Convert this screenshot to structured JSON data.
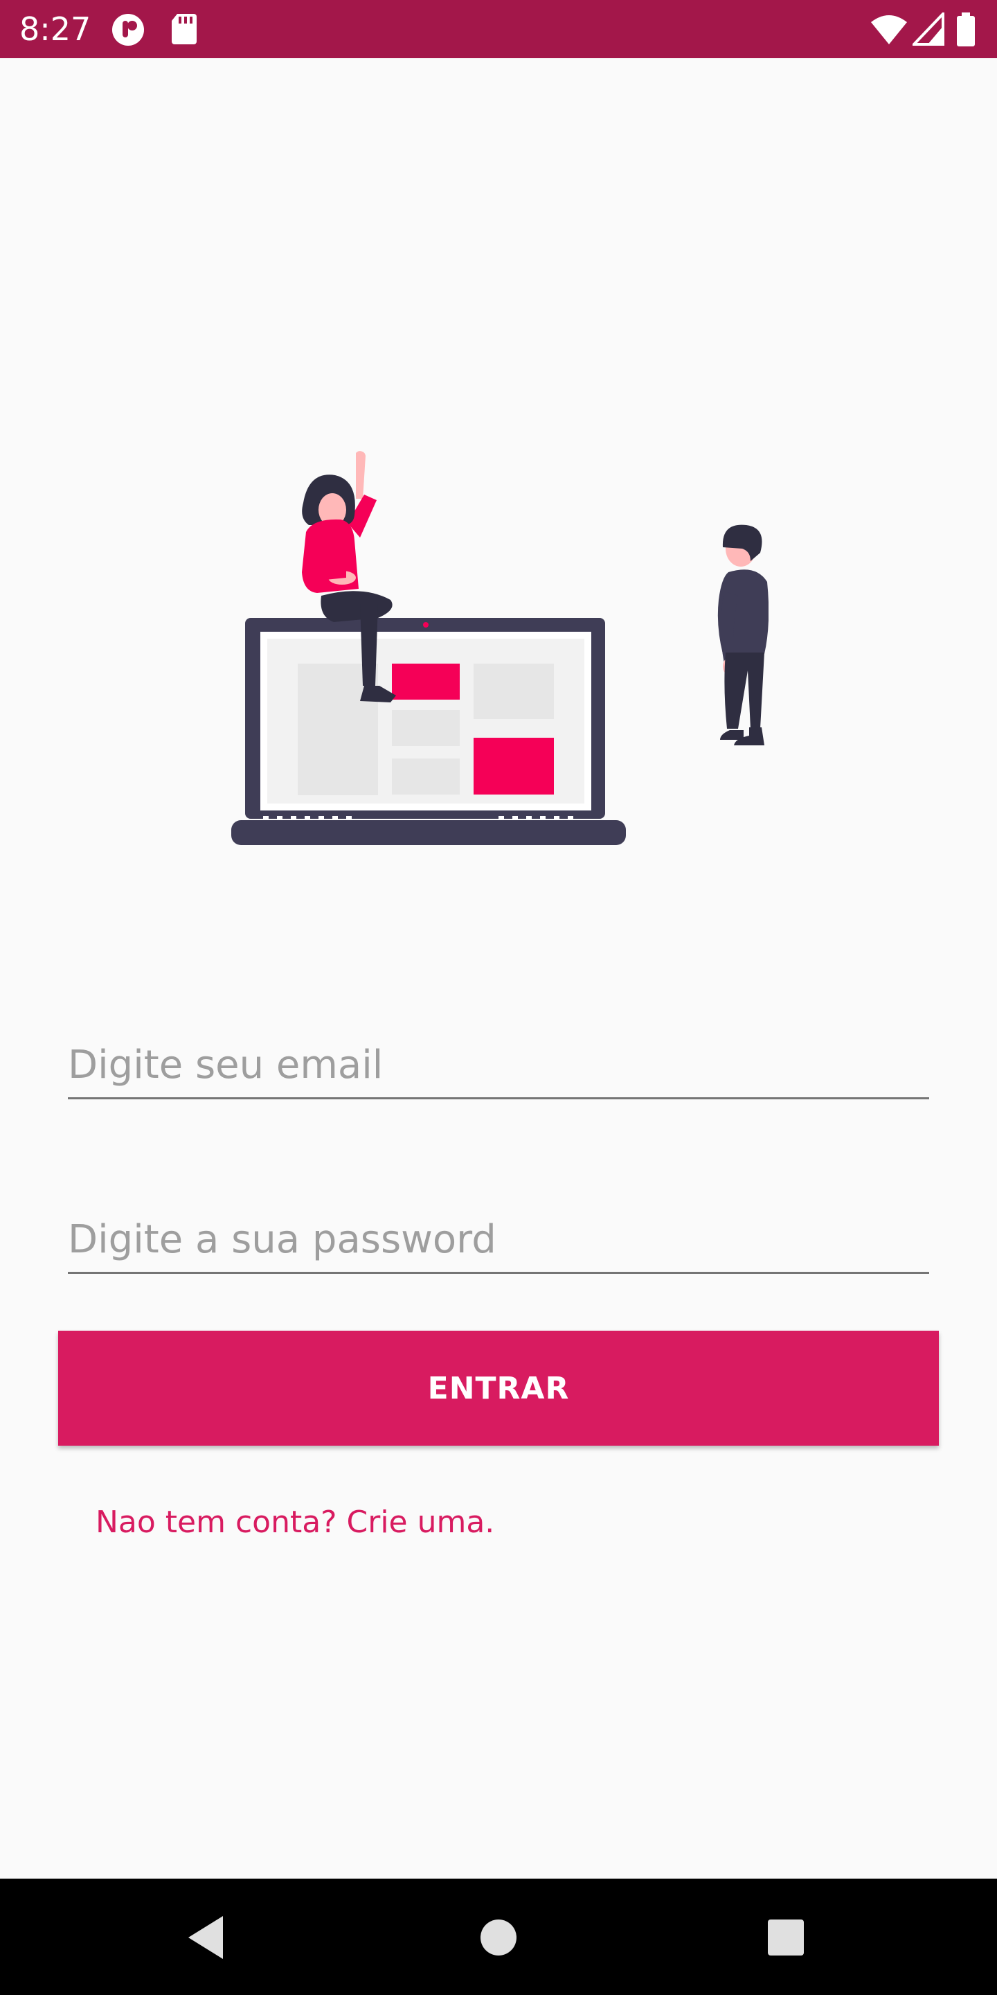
{
  "status_bar": {
    "time": "8:27",
    "bg_color": "#a3174a",
    "icons": [
      "notification-app-icon",
      "sd-card-icon",
      "wifi-icon",
      "cell-signal-icon",
      "battery-icon"
    ]
  },
  "illustration": {
    "name": "laptop-people-illustration",
    "accent_color": "#f50057",
    "dark_color": "#3f3d56"
  },
  "form": {
    "email": {
      "placeholder": "Digite seu email",
      "value": ""
    },
    "password": {
      "placeholder": "Digite a sua password",
      "value": ""
    },
    "submit_label": "ENTRAR",
    "signup_text": "Nao tem conta? Crie uma.",
    "accent_color": "#d81b60"
  },
  "nav_bar": {
    "icons": [
      "back-icon",
      "home-icon",
      "recents-icon"
    ]
  }
}
